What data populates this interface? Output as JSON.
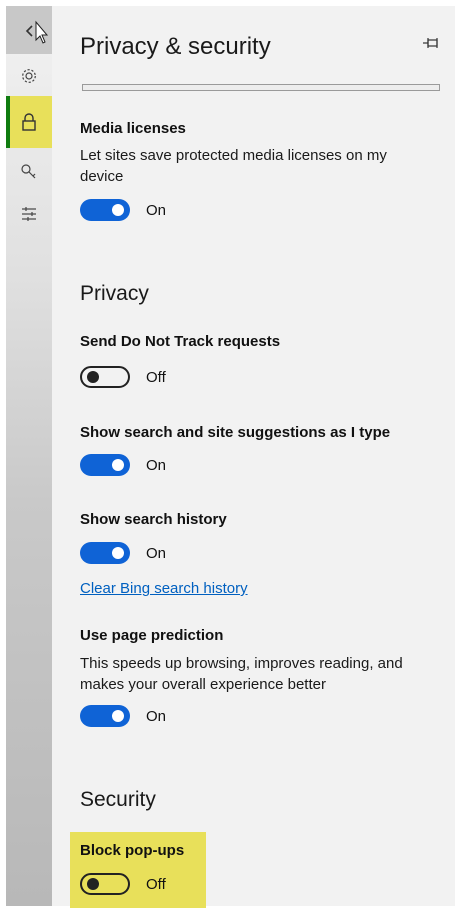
{
  "rail": {
    "items": [
      {
        "icon": "back-chevron-icon",
        "active": false
      },
      {
        "icon": "gear-icon",
        "active": false
      },
      {
        "icon": "lock-icon",
        "active": true
      },
      {
        "icon": "key-icon",
        "active": false
      },
      {
        "icon": "sliders-icon",
        "active": false
      }
    ],
    "highlight_color": "#e8e05a",
    "active_bar_color": "#107c10"
  },
  "panel": {
    "title": "Privacy & security",
    "pin_icon": "pin-icon"
  },
  "media": {
    "label": "Media licenses",
    "description": "Let sites save protected media licenses on my device",
    "toggle_state": "On"
  },
  "privacy": {
    "heading": "Privacy",
    "dnt_label": "Send Do Not Track requests",
    "dnt_state": "Off",
    "suggestions_label": "Show search and site suggestions as I type",
    "suggestions_state": "On",
    "history_label": "Show search history",
    "history_state": "On",
    "clear_link": "Clear Bing search history",
    "prediction_label": "Use page prediction",
    "prediction_description": "This speeds up browsing, improves reading, and makes your overall experience better",
    "prediction_state": "On"
  },
  "security": {
    "heading": "Security",
    "popups_label": "Block pop-ups",
    "popups_state": "Off"
  },
  "colors": {
    "toggle_on": "#0f63d6",
    "link": "#0060c0",
    "highlight": "#e8e05a"
  }
}
